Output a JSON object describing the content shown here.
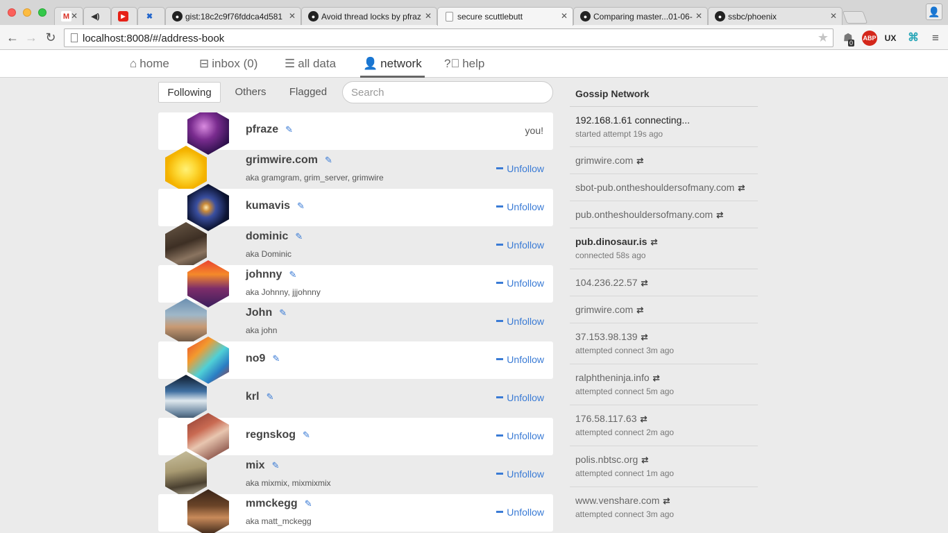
{
  "browser": {
    "tabs": [
      {
        "title": "",
        "favicon": "gmail-icon"
      },
      {
        "title": "",
        "favicon": "speaker-icon"
      },
      {
        "title": "",
        "favicon": "youtube-icon"
      },
      {
        "title": "",
        "favicon": "x-icon"
      },
      {
        "title": "gist:18c2c9f76fddca4d581",
        "favicon": "github-icon"
      },
      {
        "title": "Avoid thread locks by pfraz",
        "favicon": "github-icon"
      },
      {
        "title": "secure scuttlebutt",
        "favicon": "document-icon"
      },
      {
        "title": "Comparing master...01-06-",
        "favicon": "github-icon"
      },
      {
        "title": "ssbc/phoenix",
        "favicon": "github-icon"
      }
    ],
    "url": "localhost:8008/#/address-book",
    "extension_badge": "0",
    "ext_abp": "ABP",
    "ext_ux": "UX"
  },
  "nav": {
    "items": [
      {
        "label": "home",
        "icon": "home-icon"
      },
      {
        "label": "inbox (0)",
        "icon": "inbox-icon"
      },
      {
        "label": "all data",
        "icon": "list-icon"
      },
      {
        "label": "network",
        "icon": "user-icon"
      },
      {
        "label": "help",
        "icon": "help-icon"
      }
    ],
    "active": "network"
  },
  "filters": {
    "tabs": [
      "Following",
      "Others",
      "Flagged"
    ],
    "active": "Following",
    "search_placeholder": "Search"
  },
  "contacts": [
    {
      "name": "pfraze",
      "aka": "",
      "action": "you!"
    },
    {
      "name": "grimwire.com",
      "aka": "aka gramgram, grim_server, grimwire",
      "action": "Unfollow"
    },
    {
      "name": "kumavis",
      "aka": "",
      "action": "Unfollow"
    },
    {
      "name": "dominic",
      "aka": "aka Dominic",
      "action": "Unfollow"
    },
    {
      "name": "johnny",
      "aka": "aka Johnny, jjjohnny",
      "action": "Unfollow"
    },
    {
      "name": "John",
      "aka": "aka john",
      "action": "Unfollow"
    },
    {
      "name": "no9",
      "aka": "",
      "action": "Unfollow"
    },
    {
      "name": "krl",
      "aka": "",
      "action": "Unfollow"
    },
    {
      "name": "regnskog",
      "aka": "",
      "action": "Unfollow"
    },
    {
      "name": "mix",
      "aka": "aka mixmix, mixmixmix",
      "action": "Unfollow"
    },
    {
      "name": "mmckegg",
      "aka": "aka matt_mckegg",
      "action": "Unfollow"
    }
  ],
  "gossip": {
    "title": "Gossip Network",
    "peers": [
      {
        "host": "192.168.1.61 connecting...",
        "status": "started attempt 19s ago",
        "swap": false,
        "style": "dark"
      },
      {
        "host": "grimwire.com",
        "status": "",
        "swap": true,
        "style": "normal"
      },
      {
        "host": "sbot-pub.ontheshouldersofmany.com",
        "status": "",
        "swap": true,
        "style": "normal"
      },
      {
        "host": "pub.ontheshouldersofmany.com",
        "status": "",
        "swap": true,
        "style": "normal"
      },
      {
        "host": "pub.dinosaur.is",
        "status": "connected 58s ago",
        "swap": true,
        "style": "strong"
      },
      {
        "host": "104.236.22.57",
        "status": "",
        "swap": true,
        "style": "normal"
      },
      {
        "host": "grimwire.com",
        "status": "",
        "swap": true,
        "style": "normal"
      },
      {
        "host": "37.153.98.139",
        "status": "attempted connect 3m ago",
        "swap": true,
        "style": "normal"
      },
      {
        "host": "ralphtheninja.info",
        "status": "attempted connect 5m ago",
        "swap": true,
        "style": "normal"
      },
      {
        "host": "176.58.117.63",
        "status": "attempted connect 2m ago",
        "swap": true,
        "style": "normal"
      },
      {
        "host": "polis.nbtsc.org",
        "status": "attempted connect 1m ago",
        "swap": true,
        "style": "normal"
      },
      {
        "host": "www.venshare.com",
        "status": "attempted connect 3m ago",
        "swap": true,
        "style": "normal"
      }
    ]
  },
  "colors": {
    "accent": "#3a7bd5",
    "page_bg": "#ebebeb",
    "row_bg": "#ffffff"
  }
}
